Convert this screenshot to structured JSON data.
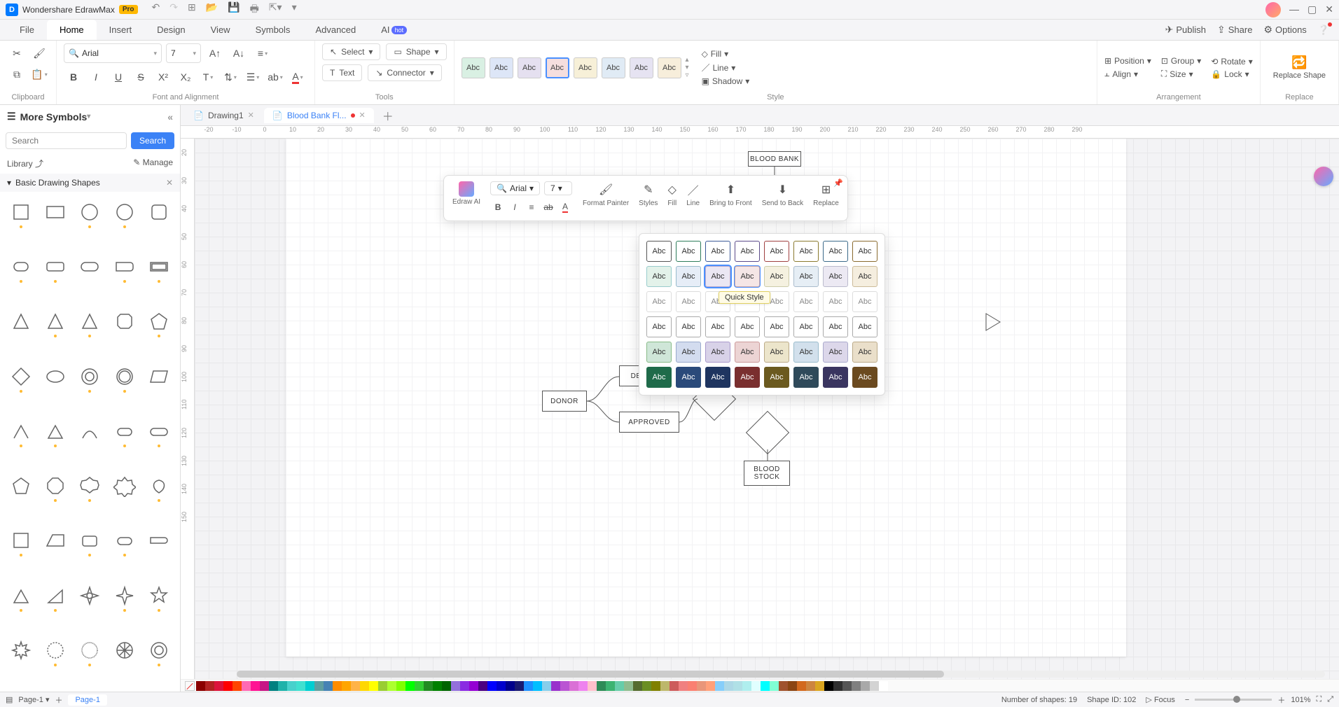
{
  "titlebar": {
    "app_name": "Wondershare EdrawMax",
    "badge": "Pro"
  },
  "menubar": {
    "tabs": [
      "File",
      "Home",
      "Insert",
      "Design",
      "View",
      "Symbols",
      "Advanced",
      "AI"
    ],
    "active": "Home",
    "hot": "hot",
    "right": {
      "publish": "Publish",
      "share": "Share",
      "options": "Options"
    }
  },
  "ribbon": {
    "font_family": "Arial",
    "font_size": "7",
    "select": "Select",
    "shape": "Shape",
    "text": "Text",
    "connector": "Connector",
    "fill": "Fill",
    "line": "Line",
    "shadow": "Shadow",
    "position": "Position",
    "align": "Align",
    "group": "Group",
    "size": "Size",
    "rotate": "Rotate",
    "lock": "Lock",
    "replace_shape": "Replace Shape",
    "groups": {
      "clipboard": "Clipboard",
      "font": "Font and Alignment",
      "tools": "Tools",
      "style": "Style",
      "arrangement": "Arrangement",
      "replace": "Replace"
    },
    "swatch": "Abc",
    "swatch_colors": [
      "#d9f0e3",
      "#dde6f7",
      "#e5e0f0",
      "#f5dede",
      "#f7f0d8",
      "#e0ebf5",
      "#e6e3f2",
      "#f7eedb"
    ]
  },
  "leftpanel": {
    "title": "More Symbols",
    "search_placeholder": "Search",
    "search_btn": "Search",
    "library": "Library",
    "manage": "Manage",
    "category": "Basic Drawing Shapes"
  },
  "doctabs": {
    "tab1": "Drawing1",
    "tab2": "Blood Bank Fl..."
  },
  "ruler_h": [
    "-20",
    "-10",
    "0",
    "10",
    "20",
    "30",
    "40",
    "50",
    "60",
    "70",
    "80",
    "90",
    "100",
    "110",
    "120",
    "130",
    "140",
    "150",
    "160",
    "170",
    "180",
    "190",
    "200",
    "210",
    "220",
    "230",
    "240",
    "250",
    "260",
    "270",
    "280",
    "290"
  ],
  "ruler_v": [
    "20",
    "30",
    "40",
    "50",
    "60",
    "70",
    "80",
    "90",
    "100",
    "110",
    "120",
    "130",
    "140",
    "150"
  ],
  "canvas_shapes": {
    "blood_bank": "BLOOD BANK",
    "donor": "DONOR",
    "denied": "DENIED",
    "approved": "APPROVED",
    "blood_stock": "BLOOD STOCK"
  },
  "floatbar": {
    "font": "Arial",
    "size": "7",
    "edraw_ai": "Edraw AI",
    "format_painter": "Format Painter",
    "styles": "Styles",
    "fill": "Fill",
    "line": "Line",
    "bring_front": "Bring to Front",
    "send_back": "Send to Back",
    "replace": "Replace"
  },
  "stylepopup": {
    "tooltip": "Quick Style",
    "rows": [
      [
        {
          "bg": "#fff",
          "bd": "#555",
          "fg": "#333"
        },
        {
          "bg": "#fff",
          "bd": "#2e7d5b",
          "fg": "#333"
        },
        {
          "bg": "#fff",
          "bd": "#3b5998",
          "fg": "#333"
        },
        {
          "bg": "#fff",
          "bd": "#5b4b8a",
          "fg": "#333"
        },
        {
          "bg": "#fff",
          "bd": "#a04040",
          "fg": "#333"
        },
        {
          "bg": "#fff",
          "bd": "#8a7a2e",
          "fg": "#333"
        },
        {
          "bg": "#fff",
          "bd": "#3b6a8a",
          "fg": "#333"
        },
        {
          "bg": "#fff",
          "bd": "#8a6a2e",
          "fg": "#333"
        }
      ],
      [
        {
          "bg": "#e3f2ea",
          "bd": "#9cc",
          "fg": "#333"
        },
        {
          "bg": "#e6edf7",
          "bd": "#9bc",
          "fg": "#333"
        },
        {
          "bg": "#ebe7f3",
          "bd": "#bac",
          "fg": "#333",
          "sel": true
        },
        {
          "bg": "#f5e6e6",
          "bd": "#caa",
          "fg": "#333",
          "hover": true
        },
        {
          "bg": "#f5f1e0",
          "bd": "#cca",
          "fg": "#333"
        },
        {
          "bg": "#e6eef5",
          "bd": "#abc",
          "fg": "#333"
        },
        {
          "bg": "#ece9f3",
          "bd": "#bbc",
          "fg": "#333"
        },
        {
          "bg": "#f5eedf",
          "bd": "#cb9",
          "fg": "#333"
        }
      ],
      [
        {
          "bg": "#fff",
          "bd": "#ddd",
          "fg": "#888"
        },
        {
          "bg": "#fff",
          "bd": "#ddd",
          "fg": "#888"
        },
        {
          "bg": "#fff",
          "bd": "#ddd",
          "fg": "#888"
        },
        {
          "bg": "#fff",
          "bd": "#ddd",
          "fg": "#888"
        },
        {
          "bg": "#fff",
          "bd": "#ddd",
          "fg": "#888"
        },
        {
          "bg": "#fff",
          "bd": "#ddd",
          "fg": "#888"
        },
        {
          "bg": "#fff",
          "bd": "#ddd",
          "fg": "#888"
        },
        {
          "bg": "#fff",
          "bd": "#ddd",
          "fg": "#888"
        }
      ],
      [
        {
          "bg": "#fff",
          "bd": "#aaa",
          "fg": "#333"
        },
        {
          "bg": "#fff",
          "bd": "#aaa",
          "fg": "#333"
        },
        {
          "bg": "#fff",
          "bd": "#aaa",
          "fg": "#333"
        },
        {
          "bg": "#fff",
          "bd": "#aaa",
          "fg": "#333"
        },
        {
          "bg": "#fff",
          "bd": "#aaa",
          "fg": "#333"
        },
        {
          "bg": "#fff",
          "bd": "#aaa",
          "fg": "#333"
        },
        {
          "bg": "#fff",
          "bd": "#aaa",
          "fg": "#333"
        },
        {
          "bg": "#fff",
          "bd": "#aaa",
          "fg": "#333"
        }
      ],
      [
        {
          "bg": "#cfe6d8",
          "bd": "#8b8",
          "fg": "#333"
        },
        {
          "bg": "#d3dcef",
          "bd": "#9ac",
          "fg": "#333"
        },
        {
          "bg": "#d8d2e8",
          "bd": "#a9c",
          "fg": "#333"
        },
        {
          "bg": "#ecd4d4",
          "bd": "#c99",
          "fg": "#333"
        },
        {
          "bg": "#ece5cb",
          "bd": "#ba8",
          "fg": "#333"
        },
        {
          "bg": "#d2e0ec",
          "bd": "#9bc",
          "fg": "#333"
        },
        {
          "bg": "#dcd7ea",
          "bd": "#aac",
          "fg": "#333"
        },
        {
          "bg": "#eadfca",
          "bd": "#ba8",
          "fg": "#333"
        }
      ],
      [
        {
          "bg": "#1f6b4a",
          "bd": "#1f6b4a",
          "fg": "#fff"
        },
        {
          "bg": "#2a4a7a",
          "bd": "#2a4a7a",
          "fg": "#fff"
        },
        {
          "bg": "#1f3560",
          "bd": "#1f3560",
          "fg": "#fff"
        },
        {
          "bg": "#7a2f2f",
          "bd": "#7a2f2f",
          "fg": "#fff"
        },
        {
          "bg": "#6b5a1f",
          "bd": "#6b5a1f",
          "fg": "#fff"
        },
        {
          "bg": "#2f4a5a",
          "bd": "#2f4a5a",
          "fg": "#fff"
        },
        {
          "bg": "#3a3560",
          "bd": "#3a3560",
          "fg": "#fff"
        },
        {
          "bg": "#6b4a1f",
          "bd": "#6b4a1f",
          "fg": "#fff"
        }
      ]
    ]
  },
  "colorbar": [
    "#8b0000",
    "#b22222",
    "#dc143c",
    "#ff0000",
    "#ff4500",
    "#ff69b4",
    "#ff1493",
    "#c71585",
    "#008080",
    "#20b2aa",
    "#48d1cc",
    "#40e0d0",
    "#00ced1",
    "#5f9ea0",
    "#4682b4",
    "#ff8c00",
    "#ffa500",
    "#ffb347",
    "#ffd700",
    "#ffff00",
    "#9acd32",
    "#adff2f",
    "#7fff00",
    "#00ff00",
    "#32cd32",
    "#228b22",
    "#008000",
    "#006400",
    "#9370db",
    "#8a2be2",
    "#9400d3",
    "#4b0082",
    "#0000ff",
    "#0000cd",
    "#00008b",
    "#191970",
    "#1e90ff",
    "#00bfff",
    "#87ceeb",
    "#9932cc",
    "#ba55d3",
    "#da70d6",
    "#ee82ee",
    "#ffc0cb",
    "#2e8b57",
    "#3cb371",
    "#66cdaa",
    "#8fbc8f",
    "#556b2f",
    "#6b8e23",
    "#808000",
    "#bdb76b",
    "#cd5c5c",
    "#f08080",
    "#fa8072",
    "#e9967a",
    "#ffa07a",
    "#87cefa",
    "#add8e6",
    "#b0e0e6",
    "#afeeee",
    "#e0ffff",
    "#00ffff",
    "#7fffd4",
    "#a0522d",
    "#8b4513",
    "#d2691e",
    "#cd853f",
    "#daa520",
    "#000000",
    "#2f2f2f",
    "#555555",
    "#808080",
    "#a9a9a9",
    "#d3d3d3",
    "#ffffff"
  ],
  "statusbar": {
    "page_sel": "Page-1",
    "page_active": "Page-1",
    "shapes_count": "Number of shapes: 19",
    "shape_id": "Shape ID: 102",
    "focus": "Focus",
    "zoom": "101%"
  }
}
